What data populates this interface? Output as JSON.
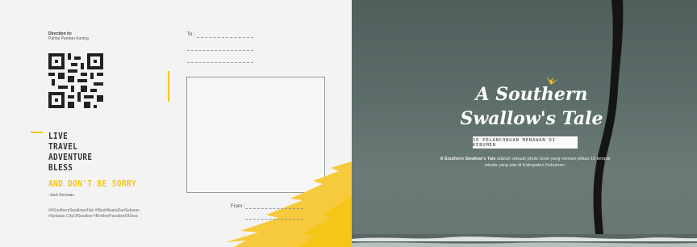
{
  "back": {
    "direction_label": "Direction to:",
    "direction_value": "Pantai Pandan Kuning",
    "to_label": "To :",
    "from_label": "From :",
    "motto": [
      "LIVE",
      "TRAVEL",
      "ADVENTURE",
      "BLESS"
    ],
    "motto_highlight": "AND DON'T BE SORRY",
    "author": "-Jack Kerouac",
    "hashtags": [
      "#ASouthernSwallowsTale #BisaWisataDariSelasan",
      "#Selasan.CityOfSwallow #BrotherParadiseOfJava"
    ],
    "accent_color": "#f5c518"
  },
  "front": {
    "title_line1": "A Southern",
    "title_line2": "Swallow's Tale",
    "subtitle": "10 PELANCONGAN MENAWAN DI KEBUMEN",
    "desc_bold": "A Southern Swallow's Tale",
    "desc_rest": " adalah sebuah photo book yang menam-pilkan 10 tempat wisata yang ada di Kabupaten Kebumen.",
    "icon": "swallow-bird-icon"
  }
}
